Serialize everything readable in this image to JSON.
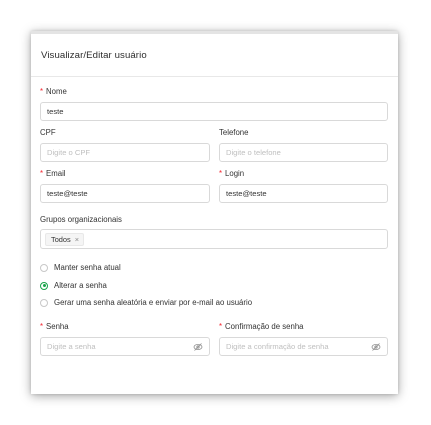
{
  "modal": {
    "title": "Visualizar/Editar usuário"
  },
  "form": {
    "nome": {
      "label": "Nome",
      "required": true,
      "value": "teste"
    },
    "cpf": {
      "label": "CPF",
      "placeholder": "Digite o CPF",
      "value": ""
    },
    "telefone": {
      "label": "Telefone",
      "placeholder": "Digite o telefone",
      "value": ""
    },
    "email": {
      "label": "Email",
      "required": true,
      "value": "teste@teste"
    },
    "login": {
      "label": "Login",
      "required": true,
      "value": "teste@teste"
    },
    "grupos": {
      "label": "Grupos organizacionais",
      "tags": [
        {
          "label": "Todos",
          "close": "×"
        }
      ]
    },
    "password_options": [
      {
        "label": "Manter senha atual",
        "checked": false
      },
      {
        "label": "Alterar a senha",
        "checked": true
      },
      {
        "label": "Gerar uma senha aleatória e enviar por e-mail ao usuário",
        "checked": false
      }
    ],
    "senha": {
      "label": "Senha",
      "required": true,
      "placeholder": "Digite a senha",
      "icon": "eye-invisible-icon"
    },
    "confirmacao": {
      "label": "Confirmação de senha",
      "required": true,
      "placeholder": "Digite a confirmação de senha",
      "icon": "eye-invisible-icon"
    }
  },
  "colors": {
    "required_mark": "#f5222d",
    "radio_checked": "#1aa34a",
    "border": "#d9d9d9",
    "placeholder": "#bfbfbf"
  }
}
